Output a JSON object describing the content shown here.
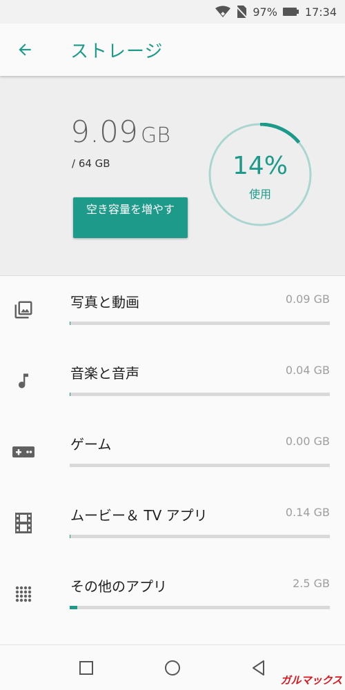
{
  "status_bar": {
    "battery": "97%",
    "time": "17:34"
  },
  "app_bar": {
    "title": "ストレージ"
  },
  "summary": {
    "used_value": "9.09",
    "used_unit": "GB",
    "total": "/ 64 GB",
    "free_button": "空き容量を増やす",
    "percent_text": "14%",
    "percent_value": 14,
    "percent_label": "使用"
  },
  "categories": [
    {
      "label": "写真と動画",
      "size": "0.09 GB",
      "fraction": 0.002,
      "icon": "photo-icon"
    },
    {
      "label": "音楽と音声",
      "size": "0.04 GB",
      "fraction": 0.001,
      "icon": "music-note-icon"
    },
    {
      "label": "ゲーム",
      "size": "0.00 GB",
      "fraction": 0.0,
      "icon": "gamepad-icon"
    },
    {
      "label": "ムービー＆ TV アプリ",
      "size": "0.14 GB",
      "fraction": 0.002,
      "icon": "film-icon"
    },
    {
      "label": "その他のアプリ",
      "size": "2.5 GB",
      "fraction": 0.03,
      "icon": "apps-grid-icon"
    }
  ],
  "colors": {
    "accent": "#1e9a8a",
    "track": "#a9d6d1"
  },
  "watermark": "ガルマックス"
}
